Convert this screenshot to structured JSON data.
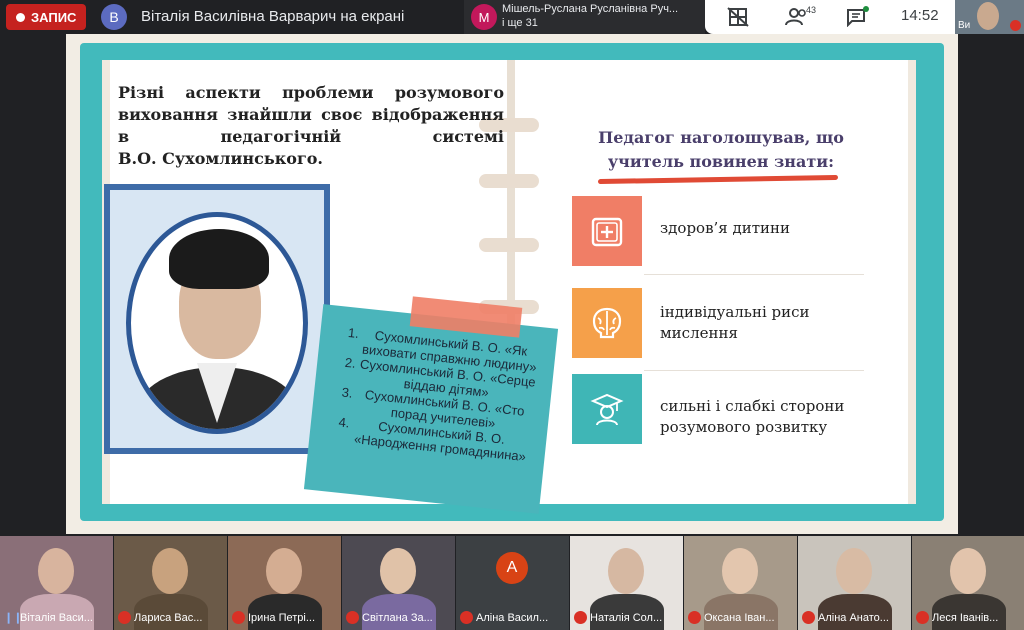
{
  "topbar": {
    "recording_label": "ЗАПИС",
    "presenter_initial": "В",
    "presenter_text": "Віталія Василівна Варварич на екрані",
    "meeting_initial": "М",
    "meeting_line1": "Мішель-Руслана Русланівна Руч...",
    "meeting_line2": "і ще 31",
    "people_count": "43",
    "clock": "14:52",
    "self_label": "Ви",
    "icons": [
      "grid-off-icon",
      "people-icon",
      "chat-icon",
      "mic-off-icon"
    ]
  },
  "slide": {
    "intro_lines": [
      "Різні аспекти проблеми розумового",
      "виховання знайшли своє відображення",
      "в педагогічній системі",
      "В.О. Сухомлинського."
    ],
    "books": [
      "Сухомлинський В. О. «Як виховати справжню людину»",
      "Сухомлинський В. О. «Серце віддаю дітям»",
      "Сухомлинський В. О. «Сто порад учителеві»",
      "Сухомлинський В. О. «Народження громадянина»"
    ],
    "right_title_line1": "Педагог наголошував, що",
    "right_title_line2": "учитель повинен знати:",
    "items": [
      {
        "text_line1": "здоров’я дитини",
        "text_line2": "",
        "color": "#f07e66",
        "icon": "health-kit-icon"
      },
      {
        "text_line1": "індивідуальні риси",
        "text_line2": "мислення",
        "color": "#f5a04a",
        "icon": "brain-icon"
      },
      {
        "text_line1": "сильні і слабкі сторони",
        "text_line2": "розумового розвитку",
        "color": "#3fb6b6",
        "icon": "graduate-icon"
      }
    ]
  },
  "participants": [
    {
      "name": "Віталія Васи...",
      "mic": "on",
      "bg": "#8a6f78",
      "face": "#d8b49e",
      "body": "#c9a8b2"
    },
    {
      "name": "Лариса Вас...",
      "mic": "off",
      "bg": "#6b5a48",
      "face": "#c8a27e",
      "body": "#5a4a38"
    },
    {
      "name": "Ірина Петрі...",
      "mic": "off",
      "bg": "#8c6a56",
      "face": "#d4ad92",
      "body": "#2a2a2a"
    },
    {
      "name": "Світлана За...",
      "mic": "off",
      "bg": "#4d4a52",
      "face": "#e0c2a8",
      "body": "#7a6aa0"
    },
    {
      "name": "Аліна Васил...",
      "mic": "off",
      "bg": "#3c4043",
      "avatar": "А"
    },
    {
      "name": "Наталія Сол...",
      "mic": "off",
      "bg": "#e7e3df",
      "face": "#d6b8a2",
      "body": "#3a3a3a"
    },
    {
      "name": "Оксана Іван...",
      "mic": "off",
      "bg": "#a79a8a",
      "face": "#e3c6ae",
      "body": "#8a7566"
    },
    {
      "name": "Аліна Анато...",
      "mic": "off",
      "bg": "#c9c4bc",
      "face": "#d8bba4",
      "body": "#4a3a32"
    },
    {
      "name": "Леся Іванів...",
      "mic": "off",
      "bg": "#8a8074",
      "face": "#e2c4ac",
      "body": "#3a3632"
    }
  ]
}
